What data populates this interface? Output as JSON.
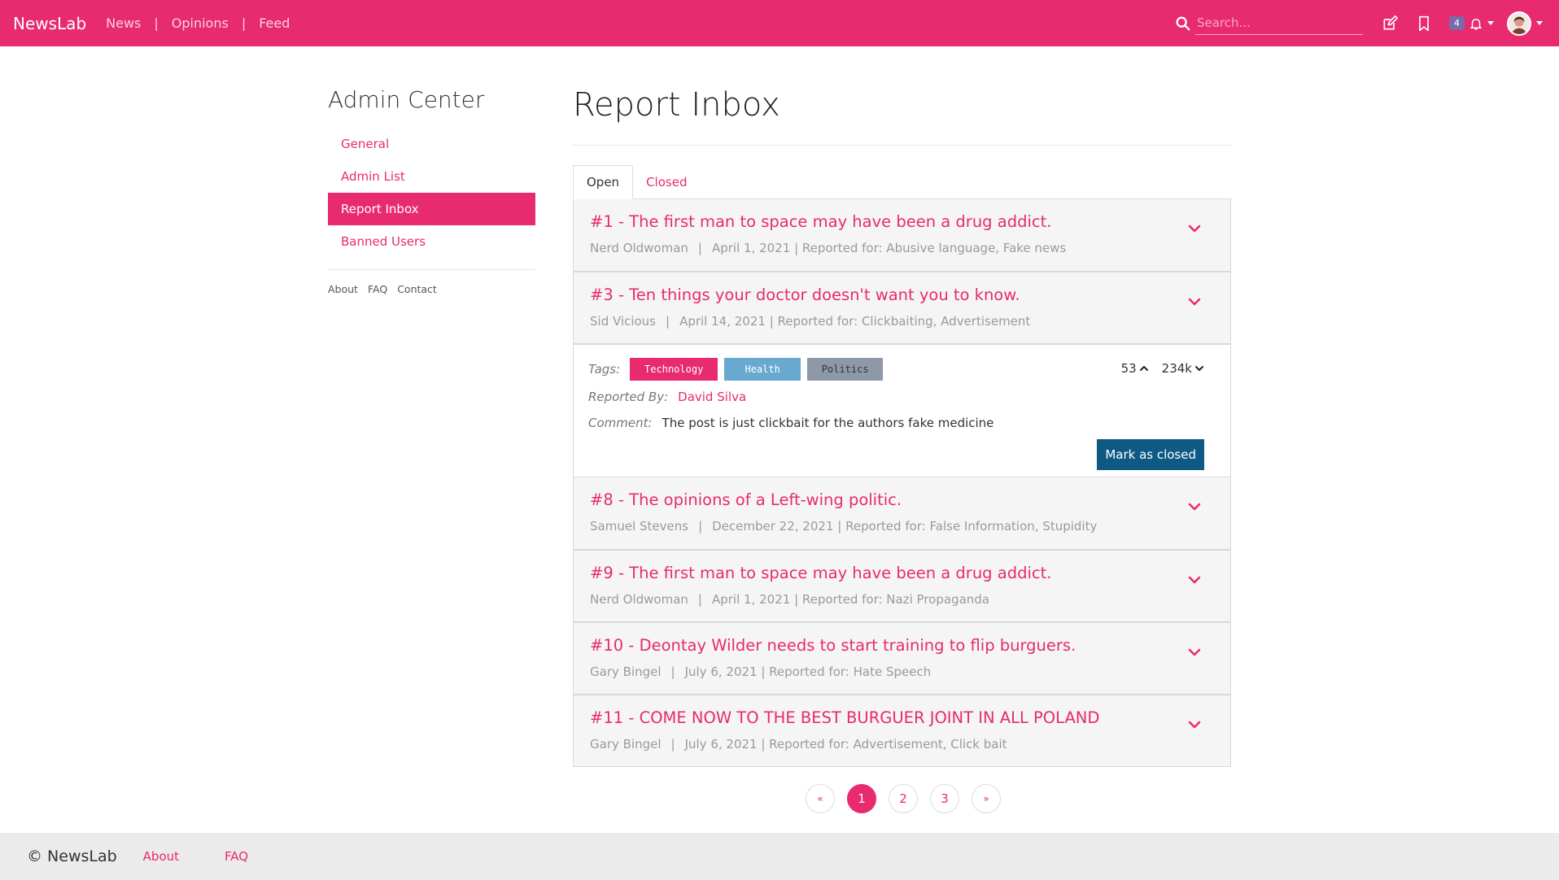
{
  "navbar": {
    "brand": "NewsLab",
    "links": [
      "News",
      "Opinions",
      "Feed"
    ],
    "search_placeholder": "Search...",
    "notification_count": "4",
    "accent": "#e82a6e"
  },
  "sidebar": {
    "title": "Admin Center",
    "items": [
      {
        "label": "General"
      },
      {
        "label": "Admin List"
      },
      {
        "label": "Report Inbox"
      },
      {
        "label": "Banned Users"
      }
    ],
    "footer_links": [
      "About",
      "FAQ",
      "Contact"
    ]
  },
  "main": {
    "title": "Report Inbox",
    "tabs": [
      "Open",
      "Closed"
    ],
    "reports": [
      {
        "title": "#1 - The first man to space may have been a drug addict.",
        "author": "Nerd Oldwoman",
        "date": "April 1, 2021",
        "reasons": "| Reported for: Abusive language, Fake news"
      },
      {
        "title": "#3 - Ten things your doctor doesn't want you to know.",
        "author": "Sid Vicious",
        "date": "April 14, 2021",
        "reasons": "| Reported for: Clickbaiting, Advertisement"
      },
      {
        "title": "#8 - The opinions of a Left-wing politic.",
        "author": "Samuel Stevens",
        "date": "December 22, 2021",
        "reasons": "| Reported for: False Information, Stupidity"
      },
      {
        "title": "#9 - The first man to space may have been a drug addict.",
        "author": "Nerd Oldwoman",
        "date": "April 1, 2021",
        "reasons": "| Reported for: Nazi Propaganda"
      },
      {
        "title": "#10 - Deontay Wilder needs to start training to flip burguers.",
        "author": "Gary Bingel",
        "date": "July 6, 2021",
        "reasons": "| Reported for: Hate Speech"
      },
      {
        "title": "#11 - COME NOW TO THE BEST BURGUER JOINT IN ALL POLAND",
        "author": "Gary Bingel",
        "date": "July 6, 2021",
        "reasons": "| Reported for: Advertisement, Click bait"
      }
    ],
    "detail": {
      "tags_label": "Tags:",
      "tags": [
        "Technology",
        "Health",
        "Politics"
      ],
      "upvotes": "53",
      "downvotes": "234k",
      "reported_by_label": "Reported By:",
      "reported_by": "David Silva",
      "comment_label": "Comment:",
      "comment": "The post is just clickbait for the authors fake medicine",
      "close_button": "Mark as closed"
    },
    "pagination": {
      "prev": "«",
      "pages": [
        "1",
        "2",
        "3"
      ],
      "current": "1",
      "next": "»"
    }
  },
  "footer": {
    "brand": "© NewsLab",
    "links": [
      "About",
      "FAQ"
    ]
  }
}
